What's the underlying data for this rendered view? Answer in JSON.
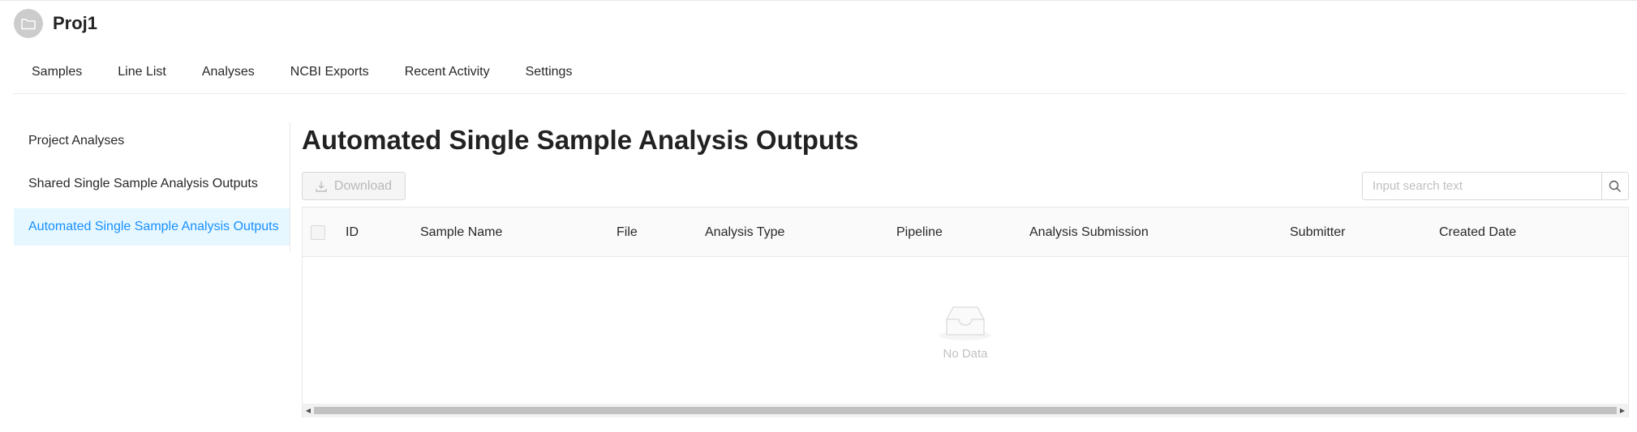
{
  "project": {
    "title": "Proj1",
    "avatar_icon": "folder-icon"
  },
  "tabs": [
    {
      "label": "Samples"
    },
    {
      "label": "Line List"
    },
    {
      "label": "Analyses"
    },
    {
      "label": "NCBI Exports"
    },
    {
      "label": "Recent Activity"
    },
    {
      "label": "Settings"
    }
  ],
  "sidebar": {
    "items": [
      {
        "label": "Project Analyses",
        "active": false
      },
      {
        "label": "Shared Single Sample Analysis Outputs",
        "active": false
      },
      {
        "label": "Automated Single Sample Analysis Outputs",
        "active": true
      }
    ]
  },
  "main": {
    "title": "Automated Single Sample Analysis Outputs",
    "download_label": "Download",
    "search_placeholder": "Input search text"
  },
  "table": {
    "columns": [
      "ID",
      "Sample Name",
      "File",
      "Analysis Type",
      "Pipeline",
      "Analysis Submission",
      "Submitter",
      "Created Date"
    ],
    "empty_text": "No Data"
  },
  "colors": {
    "accent": "#1890ff",
    "active_bg": "#e6f7ff",
    "border": "#e8e8e8"
  }
}
